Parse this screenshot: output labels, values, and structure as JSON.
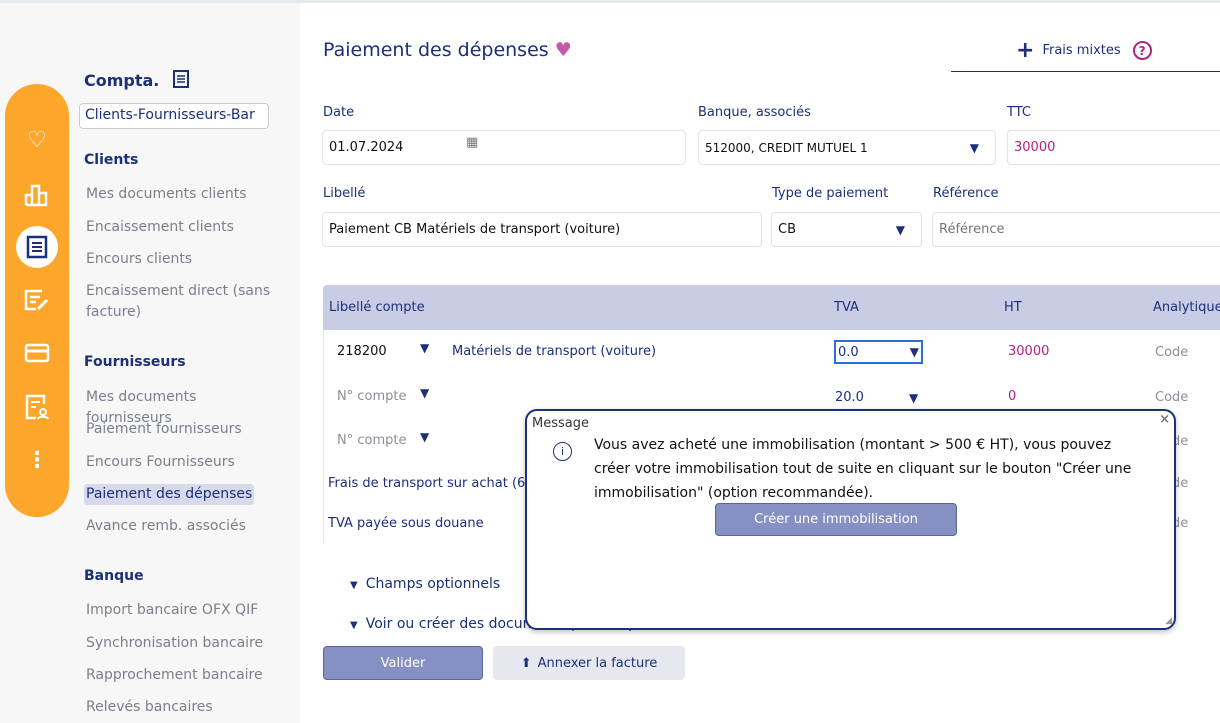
{
  "nav": {
    "title": "Compta.",
    "selector": "Clients-Fournisseurs-Bar",
    "sections": [
      {
        "title": "Clients",
        "items": [
          "Mes documents clients",
          "Encaissement clients",
          "Encours clients",
          "Encaissement direct (sans facture)"
        ]
      },
      {
        "title": "Fournisseurs",
        "items": [
          "Mes documents fournisseurs",
          "Paiement fournisseurs",
          "Encours Fournisseurs",
          "Paiement des dépenses",
          "Avance remb. associés"
        ]
      },
      {
        "title": "Banque",
        "items": [
          "Import bancaire OFX QIF",
          "Synchronisation bancaire",
          "Rapprochement bancaire",
          "Relevés bancaires"
        ]
      }
    ],
    "current": "Paiement des dépenses"
  },
  "rail": {
    "color": "#fca62b",
    "icons": [
      "heart-icon",
      "bar-chart-icon",
      "receipt-icon",
      "edit-document-icon",
      "credit-card-icon",
      "report-icon",
      "more-icon"
    ],
    "active": "receipt-icon"
  },
  "header": {
    "title": "Paiement des dépenses",
    "frais_mixtes": "Frais mixtes"
  },
  "form": {
    "date_label": "Date",
    "date_value": "01.07.2024",
    "bank_label": "Banque, associés",
    "bank_value": "512000, CREDIT MUTUEL 1",
    "ttc_label": "TTC",
    "ttc_value": "30000",
    "libelle_label": "Libellé",
    "libelle_value": "Paiement CB Matériels de transport (voiture)",
    "type_label": "Type de paiement",
    "type_value": "CB",
    "ref_label": "Référence",
    "ref_placeholder": "Référence"
  },
  "table": {
    "headers": [
      "Libellé compte",
      "TVA",
      "HT",
      "Analytique"
    ],
    "rows": [
      {
        "account": "218200",
        "name": "Matériels de transport (voiture)",
        "tva": "0.0",
        "ht": "30000",
        "code": "Code"
      },
      {
        "account": "N° compte",
        "name": "",
        "tva": "20.0",
        "ht": "0",
        "code": "Code"
      },
      {
        "account": "N° compte",
        "name": "",
        "tva": "",
        "ht": "",
        "code": "Code"
      },
      {
        "account": "",
        "name": "Frais de transport sur achat (6",
        "tva": "",
        "ht": "",
        "code": "Code"
      },
      {
        "account": "",
        "name": "TVA payée sous douane",
        "tva": "",
        "ht": "",
        "code": "Code"
      }
    ]
  },
  "optional": "Champs optionnels",
  "docs": "Voir ou créer des documents pour ce paiement",
  "validate": "Valider",
  "attach": "Annexer la facture",
  "dialog": {
    "title": "Message",
    "text": "Vous avez acheté une immobilisation (montant > 500 € HT), vous pouvez créer votre immobilisation tout de suite en cliquant sur le bouton \"Créer une immobilisation\" (option recommandée).",
    "button": "Créer une immobilisation"
  }
}
